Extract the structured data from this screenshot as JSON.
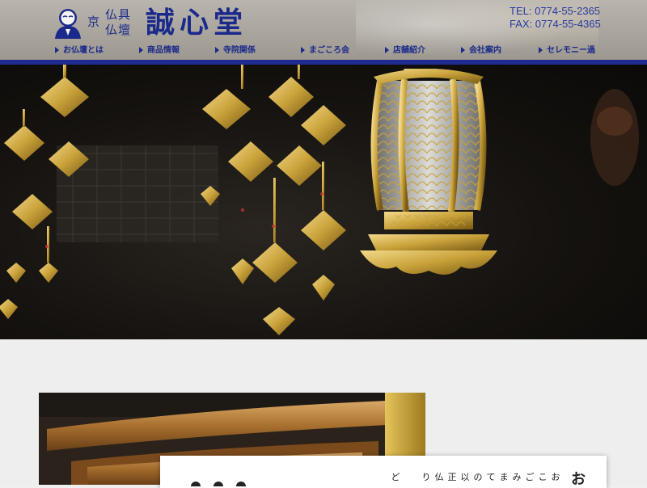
{
  "logo": {
    "small_left": "京",
    "small_line1": "仏具",
    "small_line2": "仏壇",
    "title": "誠心堂"
  },
  "contact": {
    "tel": "TEL: 0774-55-2365",
    "fax": "FAX: 0774-55-4365"
  },
  "nav": {
    "items": [
      {
        "label": "お仏壇とは"
      },
      {
        "label": "商品情報"
      },
      {
        "label": "寺院関係"
      },
      {
        "label": "まごころ会"
      },
      {
        "label": "店舗紹介"
      },
      {
        "label": "会社案内"
      },
      {
        "label": "セレモニー過"
      }
    ]
  },
  "colors": {
    "brand": "#1b2a8a",
    "nav_rule": "#1f2b8f",
    "gold": "#c9a23a"
  },
  "intro": {
    "vertical_chars": [
      "お",
      "こ",
      "ご",
      "み",
      "ま",
      "て",
      "の",
      "以",
      "正",
      "仏",
      "り",
      "ど"
    ],
    "edge_char": "お"
  }
}
